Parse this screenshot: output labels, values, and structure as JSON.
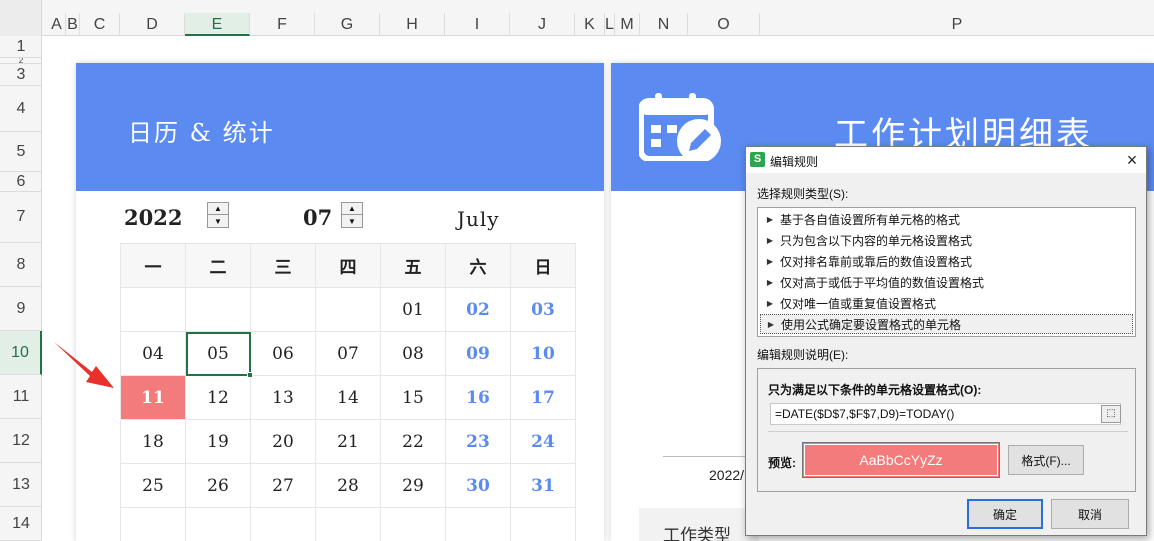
{
  "spreadsheet": {
    "columns": [
      {
        "label": "A",
        "left": 0
      },
      {
        "label": "B",
        "left": 0
      },
      {
        "label": "C",
        "left": 0
      },
      {
        "label": "D",
        "left": 0
      },
      {
        "label": "E",
        "left": 0
      },
      {
        "label": "F",
        "left": 0
      },
      {
        "label": "G",
        "left": 0
      },
      {
        "label": "H",
        "left": 0
      },
      {
        "label": "I",
        "left": 0
      },
      {
        "label": "J",
        "left": 0
      },
      {
        "label": "K",
        "left": 0
      },
      {
        "label": "L",
        "left": 0
      },
      {
        "label": "M",
        "left": 0
      },
      {
        "label": "N",
        "left": 0
      },
      {
        "label": "O",
        "left": 0
      },
      {
        "label": "P",
        "left": 0
      }
    ],
    "rows": [
      "1",
      "2",
      "3",
      "4",
      "5",
      "6",
      "7",
      "8",
      "9",
      "10",
      "11",
      "12",
      "13",
      "14"
    ],
    "active_column": "E",
    "active_row": "10"
  },
  "calendar": {
    "banner_title": "日历 & 统计",
    "year": "2022",
    "month": "07",
    "month_name": "July",
    "weekdays": [
      "一",
      "二",
      "三",
      "四",
      "五",
      "六",
      "日"
    ],
    "weeks": [
      [
        "",
        "",
        "",
        "",
        "01",
        "02",
        "03"
      ],
      [
        "04",
        "05",
        "06",
        "07",
        "08",
        "09",
        "10"
      ],
      [
        "11",
        "12",
        "13",
        "14",
        "15",
        "16",
        "17"
      ],
      [
        "18",
        "19",
        "20",
        "21",
        "22",
        "23",
        "24"
      ],
      [
        "25",
        "26",
        "27",
        "28",
        "29",
        "30",
        "31"
      ],
      [
        "",
        "",
        "",
        "",
        "",
        "",
        ""
      ]
    ],
    "today": "11",
    "selected": "05"
  },
  "plan": {
    "title": "工作计划明细表",
    "date_partial": "2022/",
    "type_label": "工作类型"
  },
  "dialog": {
    "app_icon": "S",
    "title": "编辑规则",
    "close": "×",
    "select_type_label": "选择规则类型(S):",
    "rule_types": [
      "基于各自值设置所有单元格的格式",
      "只为包含以下内容的单元格设置格式",
      "仅对排名靠前或靠后的数值设置格式",
      "仅对高于或低于平均值的数值设置格式",
      "仅对唯一值或重复值设置格式",
      "使用公式确定要设置格式的单元格"
    ],
    "selected_rule_index": 5,
    "description_label": "编辑规则说明(E):",
    "condition_label": "只为满足以下条件的单元格设置格式(O):",
    "formula": "=DATE($D$7,$F$7,D9)=TODAY()",
    "preview_label": "预览:",
    "preview_text": "AaBbCcYyZz",
    "format_button": "格式(F)...",
    "ok_button": "确定",
    "cancel_button": "取消"
  },
  "colors": {
    "banner_blue": "#5b8bf0",
    "today_red": "#f47b7b",
    "weekend_blue": "#5b8bf0",
    "selection_green": "#217346",
    "arrow_red": "#e8302c"
  }
}
